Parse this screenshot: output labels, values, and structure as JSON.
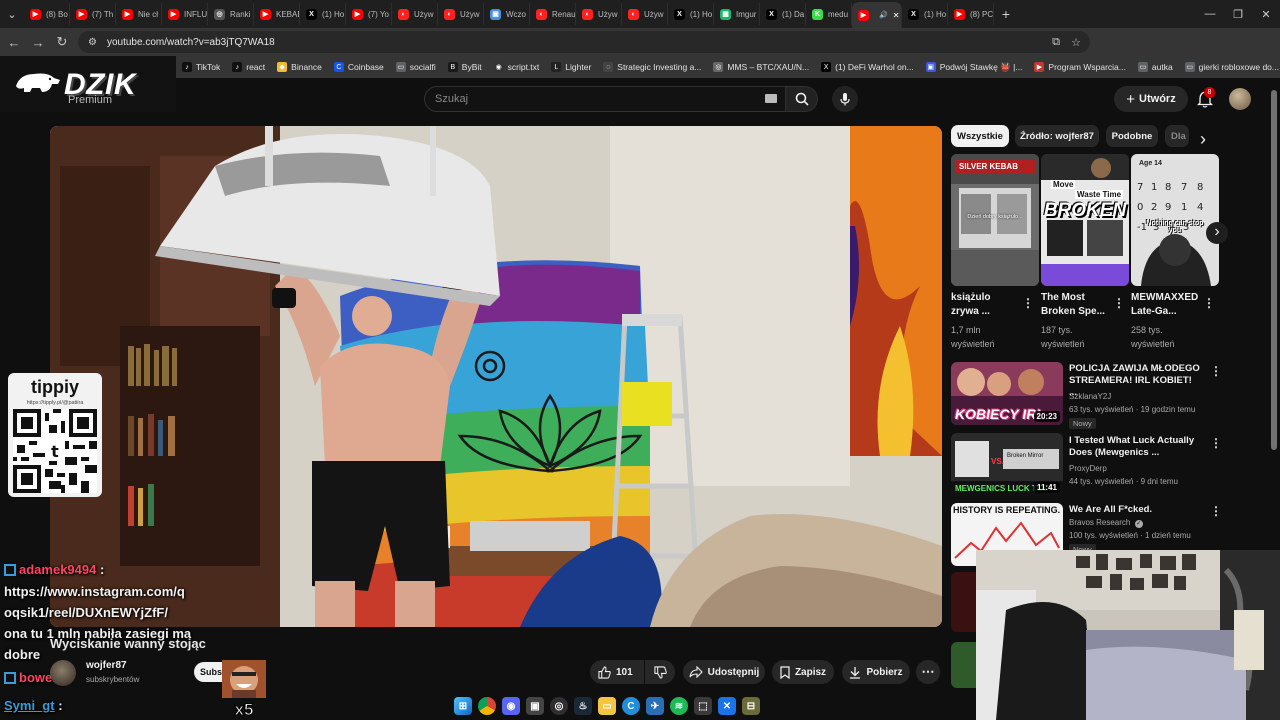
{
  "browser": {
    "tabs": [
      {
        "label": "(8) Bo",
        "fav_color": "#ff0000",
        "fav_glyph": "▶"
      },
      {
        "label": "(7) Th",
        "fav_color": "#ff0000",
        "fav_glyph": "▶"
      },
      {
        "label": "Nie cł",
        "fav_color": "#ff0000",
        "fav_glyph": "▶"
      },
      {
        "label": "INFLU",
        "fav_color": "#ff0000",
        "fav_glyph": "▶"
      },
      {
        "label": "Ranki",
        "fav_color": "#555555",
        "fav_glyph": "◎"
      },
      {
        "label": "KEBAB",
        "fav_color": "#ff0000",
        "fav_glyph": "▶"
      },
      {
        "label": "(1) Ho",
        "fav_color": "#000000",
        "fav_glyph": "X"
      },
      {
        "label": "(7) Yo",
        "fav_color": "#ff0000",
        "fav_glyph": "▶"
      },
      {
        "label": "Używ",
        "fav_color": "#ff2020",
        "fav_glyph": "◐"
      },
      {
        "label": "Używ",
        "fav_color": "#ff2020",
        "fav_glyph": "◐"
      },
      {
        "label": "Wczo",
        "fav_color": "#4a90e2",
        "fav_glyph": "▣"
      },
      {
        "label": "Renau",
        "fav_color": "#ff2020",
        "fav_glyph": "◐"
      },
      {
        "label": "Używ",
        "fav_color": "#ff2020",
        "fav_glyph": "◐"
      },
      {
        "label": "Używ",
        "fav_color": "#ff2020",
        "fav_glyph": "◐"
      },
      {
        "label": "(1) Ho",
        "fav_color": "#000000",
        "fav_glyph": "X"
      },
      {
        "label": "Imgur",
        "fav_color": "#1bb76e",
        "fav_glyph": "▦"
      },
      {
        "label": "(1) Da",
        "fav_color": "#000000",
        "fav_glyph": "X"
      },
      {
        "label": "medu",
        "fav_color": "#3ddc4a",
        "fav_glyph": "K"
      },
      {
        "label": "",
        "fav_color": "#ff0000",
        "fav_glyph": "▶",
        "active": true
      },
      {
        "label": "(1) Ho",
        "fav_color": "#000000",
        "fav_glyph": "X"
      },
      {
        "label": "(8) PC",
        "fav_color": "#ff0000",
        "fav_glyph": "▶"
      }
    ],
    "new_tab_glyph": "+",
    "url": "youtube.com/watch?v=ab3jTQ7WA18",
    "bookmarks": [
      {
        "label": "TikTok",
        "color": "#111111",
        "glyph": "♪"
      },
      {
        "label": "react",
        "color": "#111111",
        "glyph": "♪"
      },
      {
        "label": "Binance",
        "color": "#f3ba2f",
        "glyph": "◆"
      },
      {
        "label": "Coinbase",
        "color": "#1652f0",
        "glyph": "C"
      },
      {
        "label": "socialfi",
        "color": "#5f6368",
        "glyph": "▭"
      },
      {
        "label": "ByBit",
        "color": "#1a1a1a",
        "glyph": "B"
      },
      {
        "label": "script.txt",
        "color": "#333333",
        "glyph": "◉"
      },
      {
        "label": "Lighter",
        "color": "#222222",
        "glyph": "L"
      },
      {
        "label": "Strategic Investing a...",
        "color": "#444444",
        "glyph": "◌"
      },
      {
        "label": "MMS – BTC/XAU/N...",
        "color": "#666666",
        "glyph": "◎"
      },
      {
        "label": "(1) DeFi Warhol on...",
        "color": "#000000",
        "glyph": "X"
      },
      {
        "label": "Podwój Stawkę 👹 |...",
        "color": "#3b5bdb",
        "glyph": "▣"
      },
      {
        "label": "Program Wsparcia...",
        "color": "#c0392b",
        "glyph": "▶"
      },
      {
        "label": "autka",
        "color": "#5f6368",
        "glyph": "▭"
      },
      {
        "label": "gierki robloxowe do...",
        "color": "#5f6368",
        "glyph": "▭"
      }
    ]
  },
  "overlay": {
    "logo_text": "DZIK",
    "logo_sub": "Premium",
    "tippy_logo": "tippiy",
    "tippy_link": "https://tipply.pl/@patiira",
    "chat": [
      {
        "user": "adamek9494",
        "sep": ":",
        "message_lines": [
          "https://www.instagram.com/q",
          "oqsik1/reel/DUXnEWYjZfF/",
          "ona tu 1 mln nabiła zasiegi ma",
          "dobre"
        ],
        "user_color": "#ff4466"
      },
      {
        "user": "bower_a",
        "sep": "",
        "message_lines": [],
        "user_color": "#ff4466"
      },
      {
        "user": "Symi_gt",
        "sep": ":",
        "message_lines": [],
        "user_color": "#3a9bdc"
      }
    ],
    "meme_caption": "x5"
  },
  "youtube": {
    "search_placeholder": "Szukaj",
    "create_label": "Utwórz",
    "notif_count": "8",
    "video": {
      "title": "Wyciskanie wanny stojąc",
      "channel": "wojfer87",
      "subscribers": "subskrybentów",
      "subscribe_label": "Subskrybuj",
      "likes": "101",
      "share_label": "Udostępnij",
      "save_label": "Zapisz",
      "download_label": "Pobierz"
    },
    "chips": [
      {
        "label": "Wszystkie",
        "selected": true
      },
      {
        "label": "Źródło: wojfer87",
        "selected": false
      },
      {
        "label": "Podobne",
        "selected": false
      },
      {
        "label": "Dla",
        "selected": false
      }
    ],
    "shorts": [
      {
        "title": "książulo zrywa ...",
        "views": "1,7 mln wyświetleń",
        "thumb_top_text": "SILVER KEBAB",
        "thumb_overlay": "Dzień dobry książulo..."
      },
      {
        "title": "The Most Broken Spe...",
        "views": "187 tys. wyświetleń",
        "thumb_top_text": "Waste Time",
        "thumb_overlay": "BROKEN",
        "thumb_sub": "Move"
      },
      {
        "title": "MEWMAXXED Late-Ga...",
        "views": "258 tys. wyświetleń",
        "thumb_top_text": "Age 14",
        "thumb_overlay": "Nothing can stop you"
      }
    ],
    "related": [
      {
        "title": "POLICJA ZAWIJA MŁODEGO STREAMERA! IRL KOBIET! ...",
        "channel": "SzklanaY2J",
        "meta": "63 tys. wyświetleń · 19 godzin temu",
        "badge": "Nowy",
        "duration": "20:23",
        "thumb_text": "KOBIECY IRL",
        "verified": false
      },
      {
        "title": "I Tested What Luck Actually Does (Mewgenics ...",
        "channel": "ProxyDerp",
        "meta": "44 tys. wyświetleń · 9 dni temu",
        "badge": "",
        "duration": "11:41",
        "thumb_text": "MEWGENICS LUCK TEST",
        "thumb_vs": "VS.",
        "thumb_mirror": "Broken Mirror",
        "verified": false
      },
      {
        "title": "We Are All F*cked.",
        "channel": "Bravos Research",
        "meta": "100 tys. wyświetleń · 1 dzień temu",
        "badge": "Nowy",
        "duration": "",
        "thumb_text": "HISTORY IS REPEATING.",
        "verified": true
      }
    ]
  },
  "icons": {
    "back": "←",
    "forward": "→",
    "reload": "↻",
    "star": "☆",
    "kebab": "⋮",
    "search": "🔍",
    "mic": "🎤",
    "bell": "🔔",
    "like": "👍",
    "dislike": "👎",
    "share": "↗",
    "save": "🔖",
    "download": "⬇",
    "chevron_right": "›"
  },
  "colors": {
    "yt_bg": "#0f0f0f",
    "chip_bg": "#272727",
    "accent_red": "#cc0000"
  }
}
